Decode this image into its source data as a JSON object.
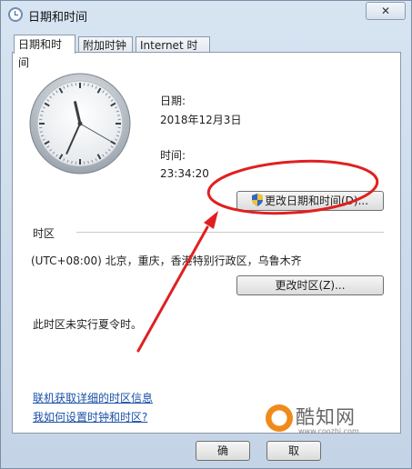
{
  "window": {
    "title": "日期和时间",
    "close_glyph": "✕"
  },
  "tabs": [
    {
      "label": "日期和时间",
      "active": true
    },
    {
      "label": "附加时钟",
      "active": false
    },
    {
      "label": "Internet 时间",
      "active": false
    }
  ],
  "datetime": {
    "date_label": "日期:",
    "date_value": "2018年12月3日",
    "time_label": "时间:",
    "time_value": "23:34:20",
    "change_button": "更改日期和时间(D)..."
  },
  "timezone": {
    "section_label": "时区",
    "value": "(UTC+08:00) 北京，重庆，香港特别行政区，乌鲁木齐",
    "change_button": "更改时区(Z)...",
    "dst_note": "此时区未实行夏令时。"
  },
  "links": {
    "online_info": "联机获取详细的时区信息",
    "how_to_set": "我如何设置时钟和时区?"
  },
  "footer": {
    "ok_fragment": "确",
    "cancel_fragment": "取"
  },
  "watermark": {
    "brand": "酷知网",
    "url": "www.coozhi.com"
  },
  "colors": {
    "annotation_red": "#e02020",
    "link_blue": "#1b50a8",
    "watermark_orange": "#f08a1a"
  },
  "clock": {
    "hour": 11,
    "minute": 34,
    "second": 20
  }
}
